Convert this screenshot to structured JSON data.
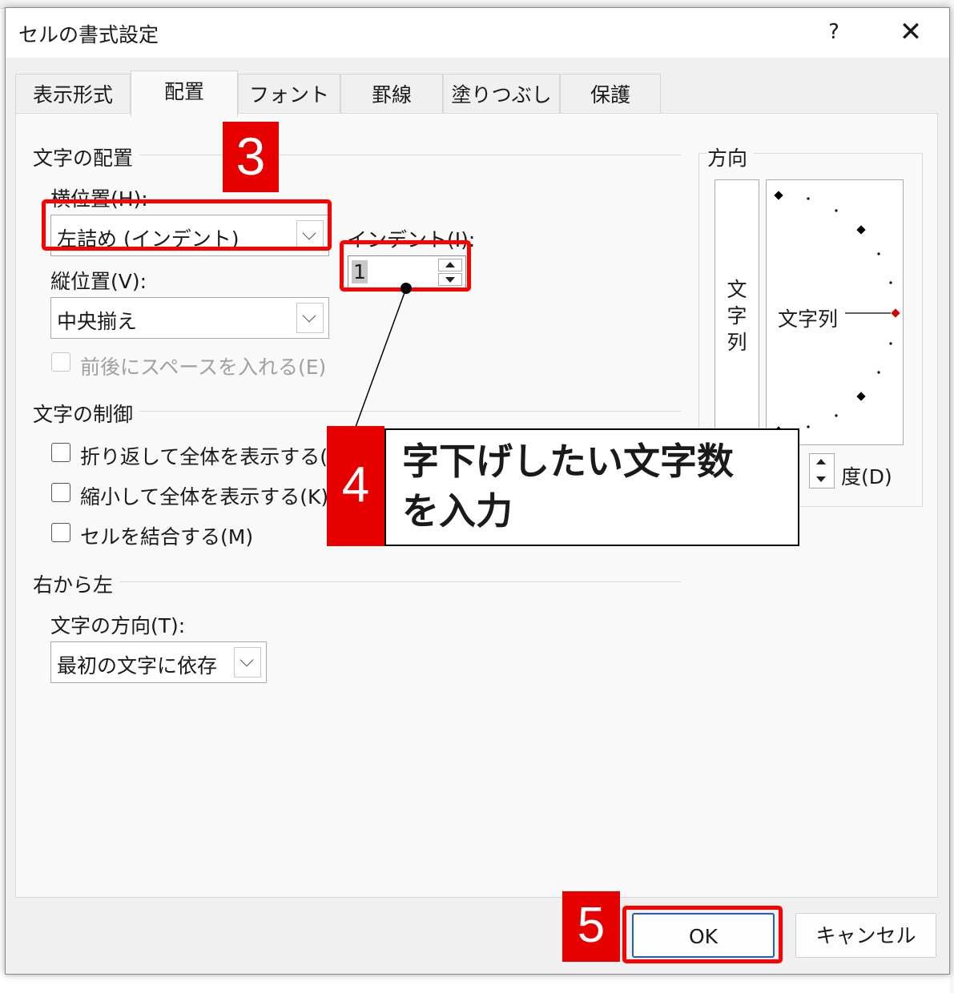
{
  "dialog": {
    "title": "セルの書式設定",
    "help_label": "?",
    "close_label": "✕"
  },
  "tabs": [
    {
      "label": "表示形式"
    },
    {
      "label": "配置"
    },
    {
      "label": "フォント"
    },
    {
      "label": "罫線"
    },
    {
      "label": "塗りつぶし"
    },
    {
      "label": "保護"
    }
  ],
  "text_alignment": {
    "section_label": "文字の配置",
    "horizontal_label": "横位置(H):",
    "horizontal_value": "左詰め (インデント)",
    "vertical_label": "縦位置(V):",
    "vertical_value": "中央揃え",
    "indent_label": "インデント(I):",
    "indent_value": "1",
    "distributed_label": "前後にスペースを入れる(E)"
  },
  "text_control": {
    "section_label": "文字の制御",
    "wrap_label": "折り返して全体を表示する(W",
    "shrink_label": "縮小して全体を表示する(K)",
    "merge_label": "セルを結合する(M)"
  },
  "rtl": {
    "section_label": "右から左",
    "direction_label": "文字の方向(T):",
    "direction_value": "最初の文字に依存"
  },
  "orientation": {
    "section_label": "方向",
    "vertical_text": [
      "文",
      "字",
      "列"
    ],
    "dial_text": "文字列",
    "degree_label": "度(D)"
  },
  "buttons": {
    "ok": "OK",
    "cancel": "キャンセル"
  },
  "annotations": {
    "step3": "3",
    "step4": "4",
    "step5": "5",
    "callout_text": "字下げしたい文字数を入力",
    "callout_line1": "字下げしたい文字数",
    "callout_line2": "を入力"
  },
  "colors": {
    "highlight": "#ff0000",
    "step_badge": "#e60000",
    "dial_marker": "#d00000"
  }
}
